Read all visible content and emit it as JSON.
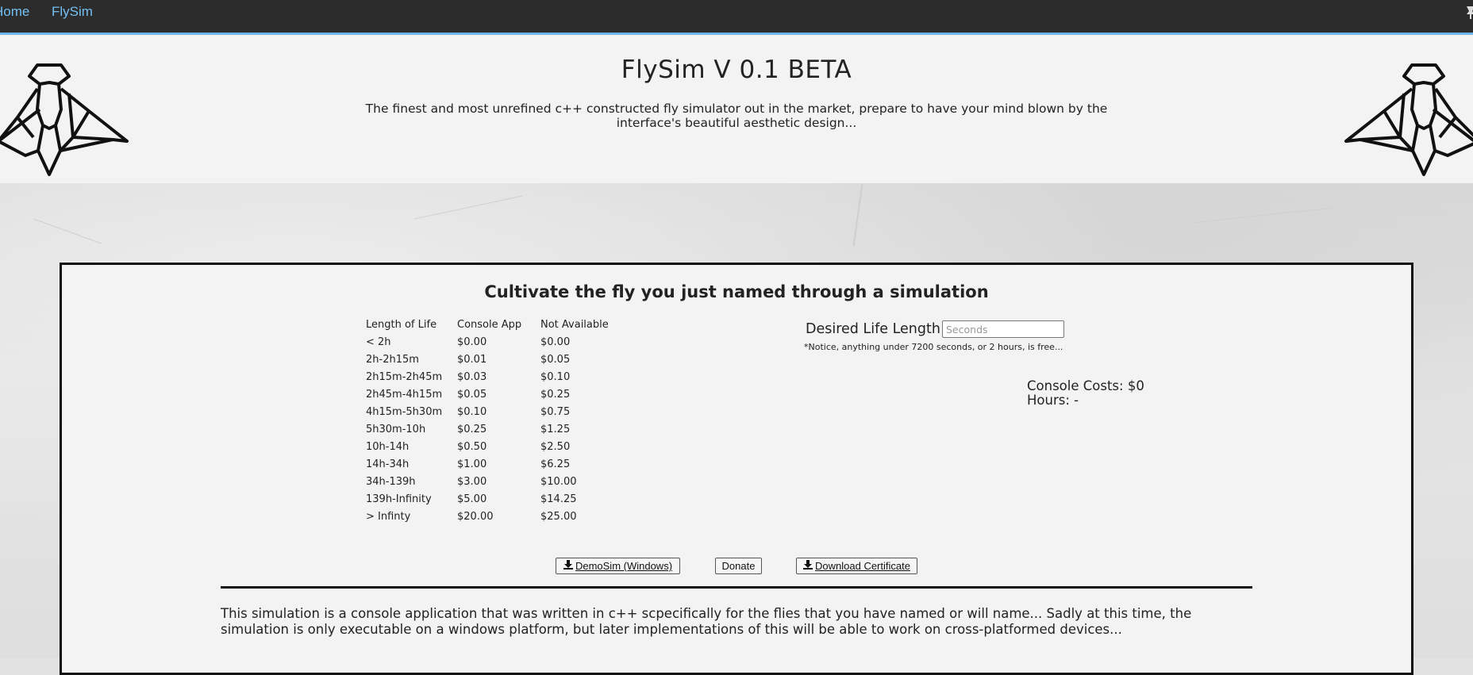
{
  "nav": {
    "home_label": "Home",
    "flysim_label": "FlySim",
    "link_color": "#74c0f4",
    "bar_color": "#2c2c2c",
    "pin_icon": "pin-icon"
  },
  "header": {
    "title": "FlySim V 0.1 BETA",
    "tagline": "The finest and most unrefined c++ constructed fly simulator out in the market, prepare to have your mind blown by the interface's beautiful aesthetic design...",
    "logo_icon": "fly-logo-icon"
  },
  "panel": {
    "title": "Cultivate the fly you just named through a simulation",
    "table": {
      "headers": [
        "Length of Life",
        "Console App",
        "Not Available"
      ],
      "rows": [
        [
          "< 2h",
          "$0.00",
          "$0.00"
        ],
        [
          "2h-2h15m",
          "$0.01",
          "$0.05"
        ],
        [
          "2h15m-2h45m",
          "$0.03",
          "$0.10"
        ],
        [
          "2h45m-4h15m",
          "$0.05",
          "$0.25"
        ],
        [
          "4h15m-5h30m",
          "$0.10",
          "$0.75"
        ],
        [
          "5h30m-10h",
          "$0.25",
          "$1.25"
        ],
        [
          "10h-14h",
          "$0.50",
          "$2.50"
        ],
        [
          "14h-34h",
          "$1.00",
          "$6.25"
        ],
        [
          "34h-139h",
          "$3.00",
          "$10.00"
        ],
        [
          "139h-Infinity",
          "$5.00",
          "$14.25"
        ],
        [
          "> Infinty",
          "$20.00",
          "$25.00"
        ]
      ]
    },
    "life_length": {
      "label": "Desired Life Length",
      "placeholder": "Seconds",
      "value": "",
      "notice": "*Notice, anything under 7200 seconds, or 2 hours, is free..."
    },
    "costs": {
      "console_label": "Console Costs: $0",
      "hours_label": "Hours: -"
    },
    "buttons": {
      "demo_label": "DemoSim (Windows)",
      "donate_label": "Donate",
      "certificate_label": "Download Certificate",
      "download_icon": "download-icon"
    },
    "description": "This simulation is a console application that was written in c++ scpecifically for the flies that you have named or will name... Sadly at this time, the simulation is only executable on a windows platform, but later implementations of this will be able to work on cross-platformed devices..."
  }
}
